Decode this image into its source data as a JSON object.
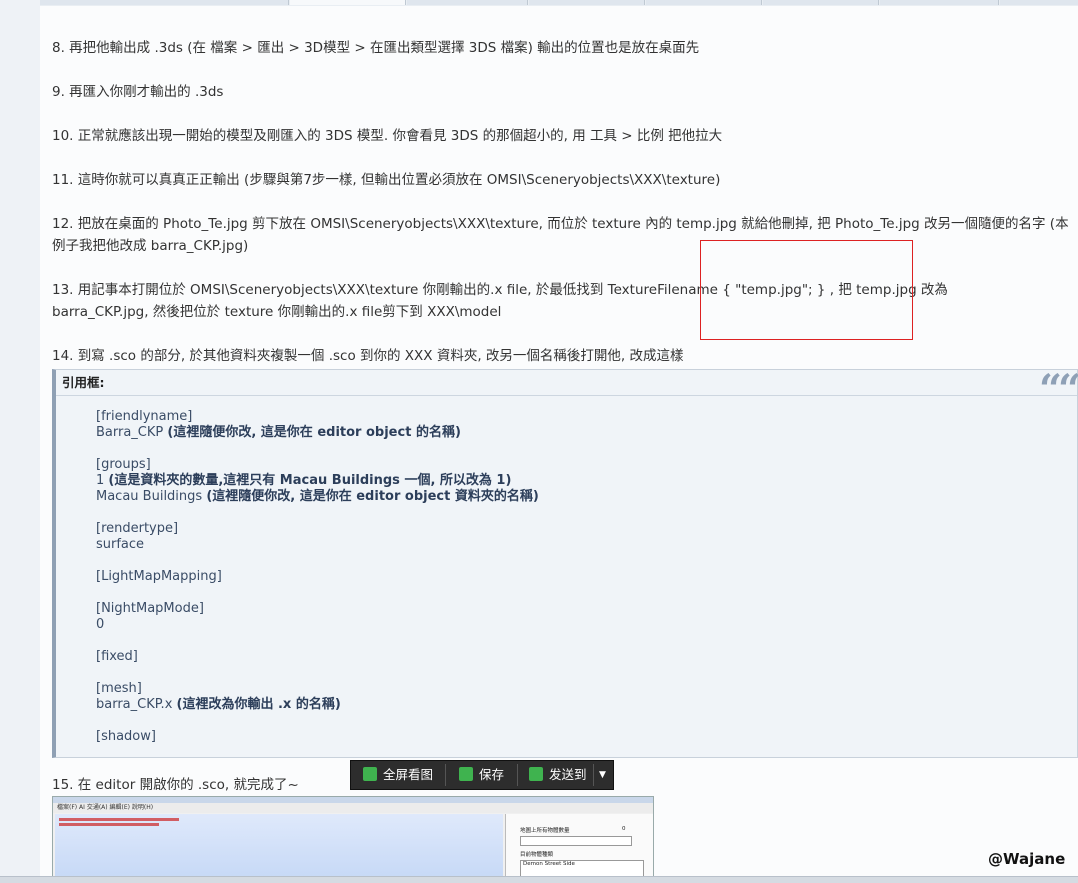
{
  "steps": [
    {
      "text": "8. 再把他輸出成 .3ds (在 檔案 > 匯出 > 3D模型 > 在匯出類型選擇 3DS 檔案) 輸出的位置也是放在桌面先"
    },
    {
      "text": "9. 再匯入你剛才輸出的 .3ds"
    },
    {
      "text": "10. 正常就應該出現一開始的模型及剛匯入的 3DS 模型. 你會看見 3DS 的那個超小的, 用 工具 > 比例 把他拉大"
    },
    {
      "text": "11. 這時你就可以真真正正輸出 (步驟與第7步一樣, 但輸出位置必須放在 OMSI\\Sceneryobjects\\XXX\\texture)"
    },
    {
      "text": "12. 把放在桌面的 Photo_Te.jpg 剪下放在 OMSI\\Sceneryobjects\\XXX\\texture, 而位於 texture 內的 temp.jpg 就給他刪掉, 把 Photo_Te.jpg  改另一個隨便的名字 (本例子我把他改成 barra_CKP.jpg)"
    },
    {
      "text": "13. 用記事本打開位於 OMSI\\Sceneryobjects\\XXX\\texture 你剛輸出的.x file, 於最低找到 TextureFilename { \"temp.jpg\"; } , 把 temp.jpg 改為 barra_CKP.jpg, 然後把位於 texture 你剛輸出的.x file剪下到 XXX\\model"
    },
    {
      "text": "14. 到寫 .sco 的部分, 於其他資料夾複製一個 .sco 到你的 XXX 資料夾, 改另一個名稱後打開他, 改成這樣"
    },
    {
      "text": "15. 在 editor 開啟你的 .sco, 就完成了~"
    }
  ],
  "quote": {
    "header": "引用框:",
    "mark": "““",
    "lines": [
      {
        "main": "[friendlyname]",
        "note": ""
      },
      {
        "main": "Barra_CKP ",
        "note": "(這裡隨便你改, 這是你在 editor object 的名稱)"
      },
      {
        "main": "[groups]",
        "note": ""
      },
      {
        "main": "1 ",
        "note": "(這是資料夾的數量,這裡只有 Macau Buildings 一個, 所以改為 1)"
      },
      {
        "main": "Macau Buildings ",
        "note": "(這裡隨便你改, 這是你在 editor object 資料夾的名稱)"
      },
      {
        "main": "[rendertype]",
        "note": ""
      },
      {
        "main": "surface",
        "note": ""
      },
      {
        "main": "[LightMapMapping]",
        "note": ""
      },
      {
        "main": "[NightMapMode]",
        "note": ""
      },
      {
        "main": "0",
        "note": ""
      },
      {
        "main": "[fixed]",
        "note": ""
      },
      {
        "main": "[mesh]",
        "note": ""
      },
      {
        "main": "barra_CKP.x ",
        "note": "(這裡改為你輸出 .x 的名稱)"
      },
      {
        "main": "[shadow]",
        "note": ""
      }
    ]
  },
  "viewer_toolbar": {
    "fullscreen_label": "全屏看图",
    "save_label": "保存",
    "send_label": "发送到"
  },
  "preview": {
    "menu": "檔案(F)   AI 交通(A)   編輯(E)   說明(H)",
    "panel_label1": "地圖上所有物體數量",
    "panel_value1": "0",
    "panel_label2": "目前物體種類",
    "panel_item1": "Demon Street Side"
  },
  "watermark": "@Wajane",
  "colors": {
    "highlight_box": "#d22222",
    "quote_border": "#8fa0b4",
    "toolbar_bg": "#2d2d2d",
    "fullscreen_icon": "#3fb34f",
    "save_icon": "#3fb34f",
    "send_icon": "#3fb34f"
  }
}
